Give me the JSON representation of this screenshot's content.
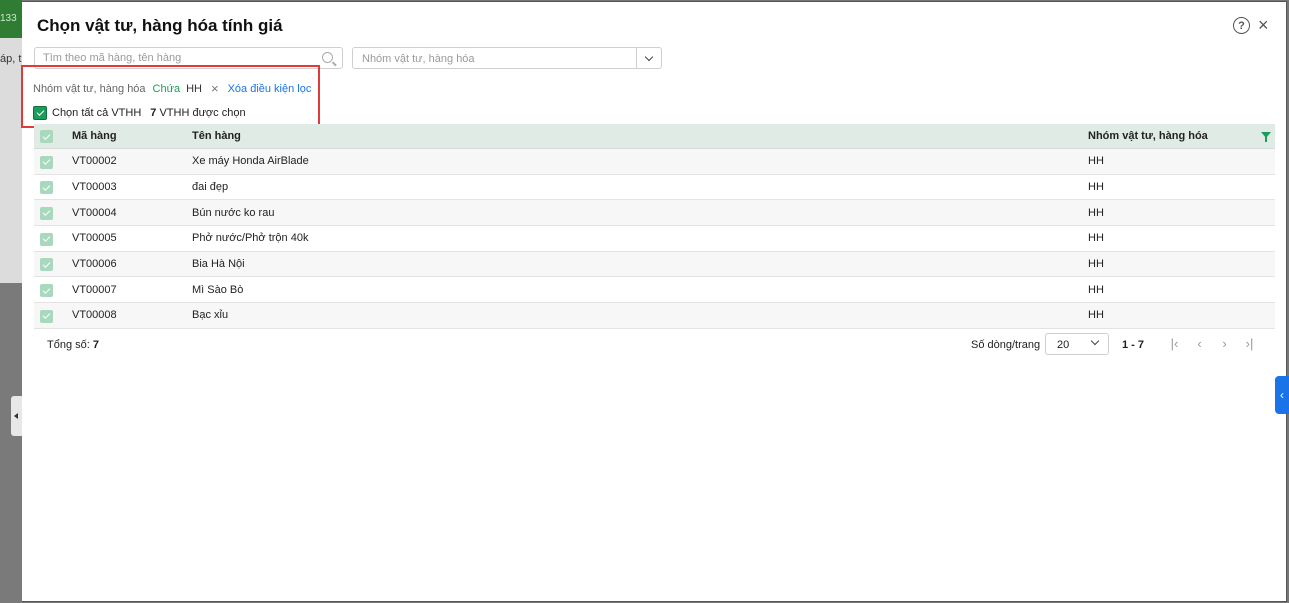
{
  "background": {
    "code_text": "133",
    "row_text": "áp, t"
  },
  "dialog": {
    "title": "Chọn vật tư, hàng hóa tính giá",
    "help_icon": "?",
    "close_icon": "×"
  },
  "search": {
    "placeholder": "Tìm theo mã hàng, tên hàng",
    "value": ""
  },
  "group_select": {
    "placeholder": "Nhóm vật tư, hàng hóa"
  },
  "filter": {
    "field": "Nhóm vật tư, hàng hóa",
    "operator": "Chứa",
    "value": "HH",
    "remove_icon": "×",
    "clear_label": "Xóa điều kiện lọc"
  },
  "selection": {
    "select_all_label": "Chọn tất cả VTHH",
    "selected_count": "7",
    "selected_suffix": "VTHH được chọn"
  },
  "table": {
    "columns": [
      "Mã hàng",
      "Tên hàng",
      "Nhóm vật tư, hàng hóa"
    ],
    "rows": [
      {
        "code": "VT00002",
        "name": "Xe máy Honda AirBlade",
        "group": "HH"
      },
      {
        "code": "VT00003",
        "name": "đai đẹp",
        "group": "HH"
      },
      {
        "code": "VT00004",
        "name": "Bún nước ko rau",
        "group": "HH"
      },
      {
        "code": "VT00005",
        "name": "Phở nước/Phở trộn 40k",
        "group": "HH"
      },
      {
        "code": "VT00006",
        "name": "Bia Hà Nội",
        "group": "HH"
      },
      {
        "code": "VT00007",
        "name": "Mì Sào Bò",
        "group": "HH"
      },
      {
        "code": "VT00008",
        "name": "Bạc xỉu",
        "group": "HH"
      }
    ]
  },
  "footer": {
    "total_label": "Tổng số:",
    "total_value": "7",
    "rows_per_page_label": "Số dòng/trang",
    "rows_per_page_value": "20",
    "range": "1 - 7",
    "pager": {
      "first": "|‹",
      "prev": "‹",
      "next": "›",
      "last": "›|"
    }
  },
  "side_tab_icon": "‹",
  "colors": {
    "accent_green": "#1a9e5a",
    "link_blue": "#1a73e8",
    "highlight_red": "#e03a3a"
  }
}
